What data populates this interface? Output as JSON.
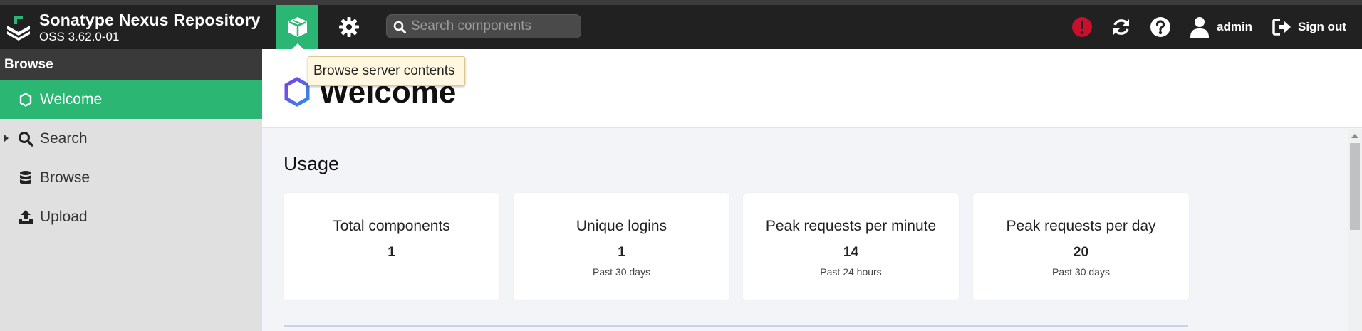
{
  "app": {
    "title": "Sonatype Nexus Repository",
    "version": "OSS 3.62.0-01",
    "logo_icon": "nexus-logo-icon"
  },
  "header": {
    "browse_mode_icon": "cube-icon",
    "admin_mode_icon": "gear-icon",
    "search": {
      "placeholder": "Search components",
      "value": ""
    },
    "status_icon": "alert-icon",
    "refresh_icon": "refresh-icon",
    "help_icon": "help-icon",
    "user": {
      "name": "admin",
      "icon": "user-icon"
    },
    "signout": {
      "label": "Sign out",
      "icon": "signout-icon"
    },
    "colors": {
      "accent": "#2bb673",
      "alert": "#c8102e",
      "bar": "#212121"
    }
  },
  "tooltip": {
    "text": "Browse server contents"
  },
  "sidebar": {
    "heading": "Browse",
    "items": [
      {
        "label": "Welcome",
        "icon": "hexagon-icon",
        "active": true
      },
      {
        "label": "Search",
        "icon": "search-icon",
        "expandable": true
      },
      {
        "label": "Browse",
        "icon": "database-icon"
      },
      {
        "label": "Upload",
        "icon": "upload-icon"
      }
    ]
  },
  "main": {
    "title": "Welcome",
    "title_icon": "hexagon-icon",
    "usage": {
      "heading": "Usage",
      "cards": [
        {
          "title": "Total components",
          "value": "1",
          "sub": ""
        },
        {
          "title": "Unique logins",
          "value": "1",
          "sub": "Past 30 days"
        },
        {
          "title": "Peak requests per minute",
          "value": "14",
          "sub": "Past 24 hours"
        },
        {
          "title": "Peak requests per day",
          "value": "20",
          "sub": "Past 30 days"
        }
      ]
    }
  }
}
